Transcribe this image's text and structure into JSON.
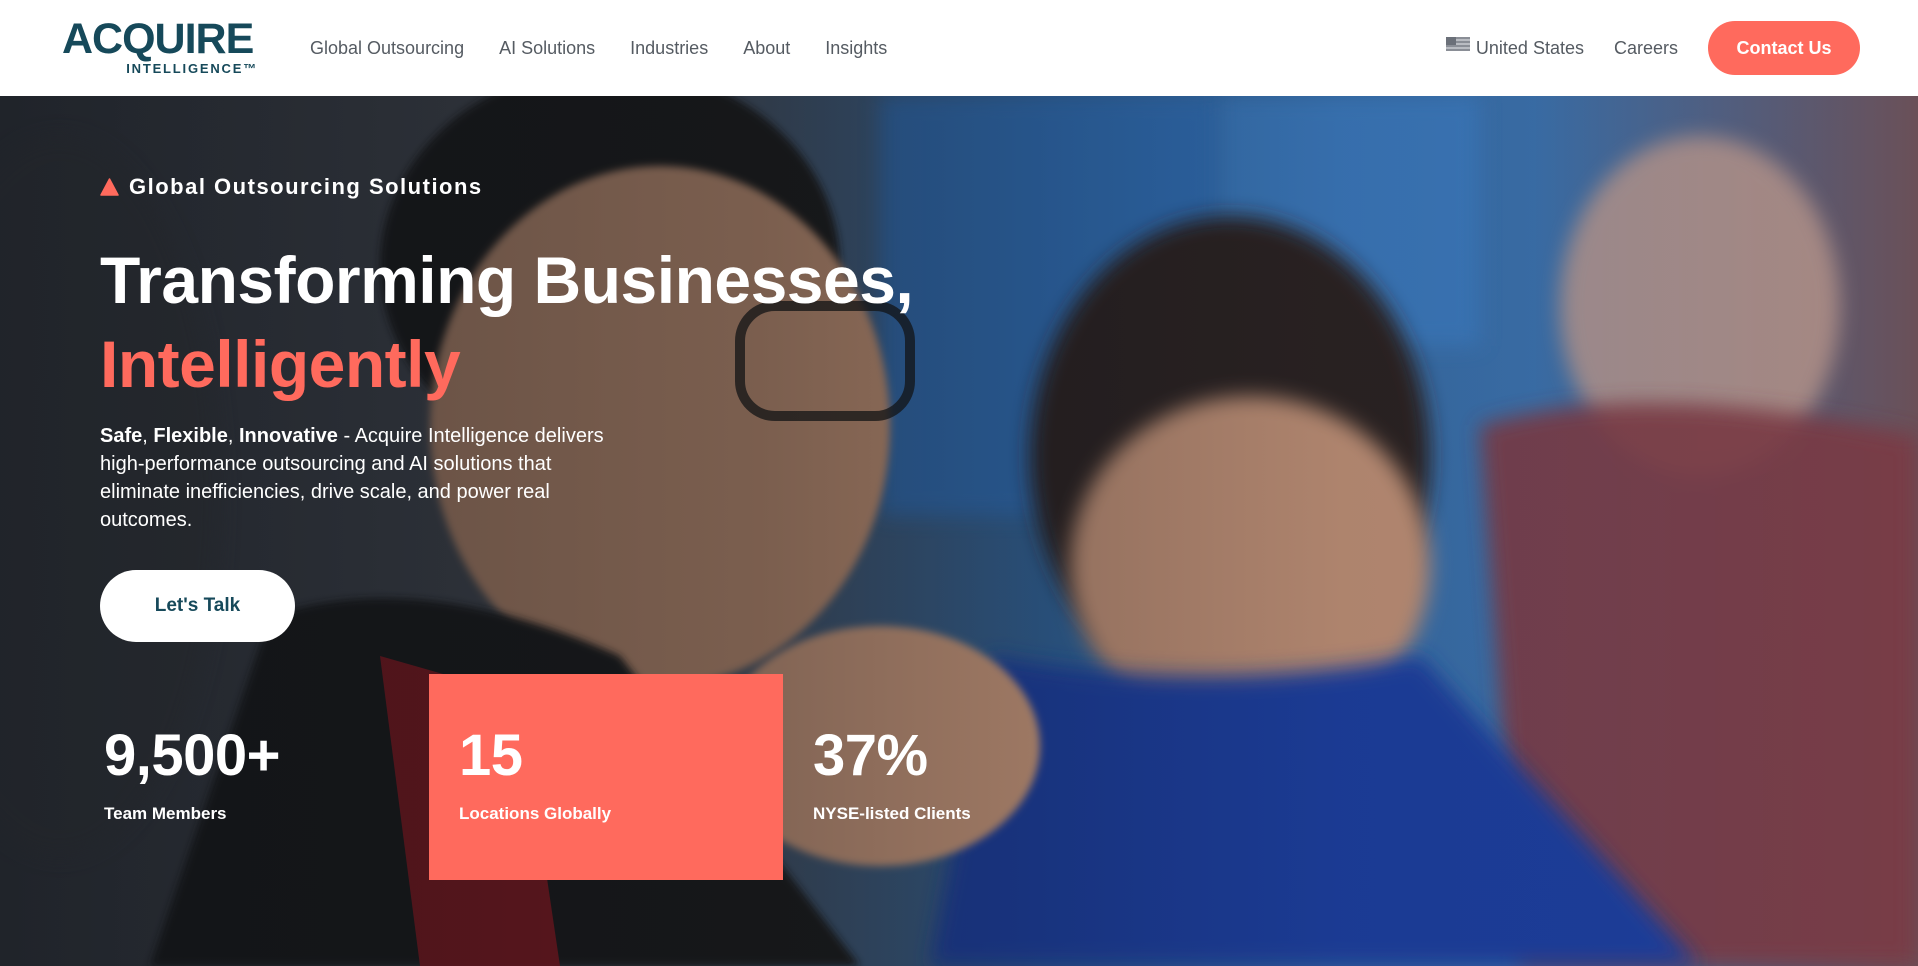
{
  "brand": {
    "logo_main": "ACQUIRE",
    "logo_sub": "INTELLIGENCE™",
    "accent_color": "#ff6a5d",
    "primary_color": "#16495a"
  },
  "nav": {
    "links": [
      "Global Outsourcing",
      "AI Solutions",
      "Industries",
      "About",
      "Insights"
    ],
    "region_label": "United States",
    "region_icon": "us-flag-icon",
    "careers_label": "Careers",
    "contact_label": "Contact Us"
  },
  "hero": {
    "eyebrow": "Global Outsourcing Solutions",
    "eyebrow_icon": "triangle-icon",
    "headline_line1": "Transforming Businesses,",
    "headline_line2": "Intelligently",
    "lead_strong_1": "Safe",
    "lead_sep_1": ", ",
    "lead_strong_2": "Flexible",
    "lead_sep_2": ", ",
    "lead_strong_3": "Innovative",
    "lead_rest": " - Acquire Intelligence delivers high-performance outsourcing and AI solutions that eliminate inefficiencies, drive scale, and power real outcomes.",
    "cta_label": "Let's Talk"
  },
  "stats": [
    {
      "value": "9,500+",
      "label": "Team Members"
    },
    {
      "value": "15",
      "label": "Locations Globally"
    },
    {
      "value": "37%",
      "label": "NYSE-listed Clients"
    }
  ]
}
